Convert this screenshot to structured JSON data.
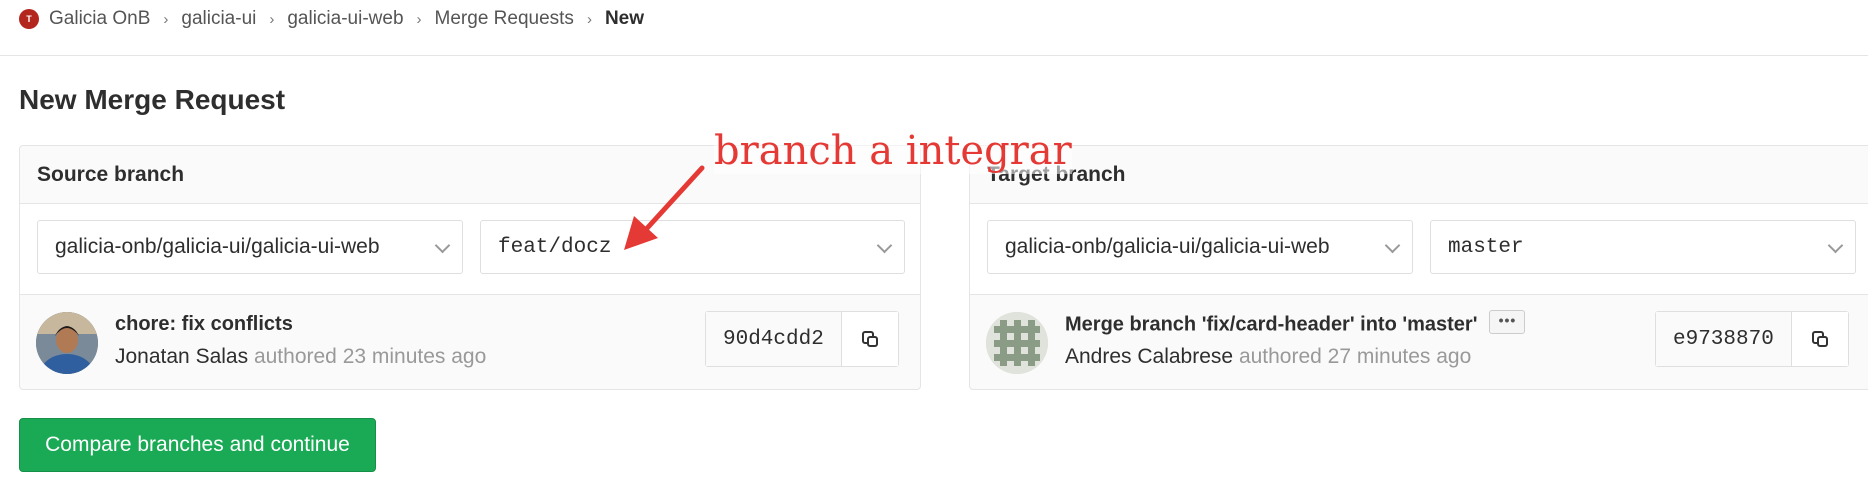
{
  "breadcrumb": {
    "logo_letter": "T",
    "items": [
      "Galicia OnB",
      "galicia-ui",
      "galicia-ui-web",
      "Merge Requests"
    ],
    "current": "New"
  },
  "page": {
    "title": "New Merge Request"
  },
  "source": {
    "header_label": "Source branch",
    "project": "galicia-onb/galicia-ui/galicia-ui-web",
    "branch": "feat/docz",
    "commit": {
      "title": "chore: fix conflicts",
      "author": "Jonatan Salas",
      "meta": "authored 23 minutes ago",
      "sha": "90d4cdd2"
    }
  },
  "target": {
    "header_label": "Target branch",
    "project": "galicia-onb/galicia-ui/galicia-ui-web",
    "branch": "master",
    "commit": {
      "title": "Merge branch 'fix/card-header' into 'master'",
      "author": "Andres Calabrese",
      "meta": "authored 27 minutes ago",
      "sha": "e9738870"
    }
  },
  "actions": {
    "compare_label": "Compare branches and continue"
  },
  "annotation": {
    "text": "branch a integrar",
    "color": "#e53935"
  },
  "colors": {
    "primary_button": "#1aaa55",
    "logo": "#b3261e"
  }
}
